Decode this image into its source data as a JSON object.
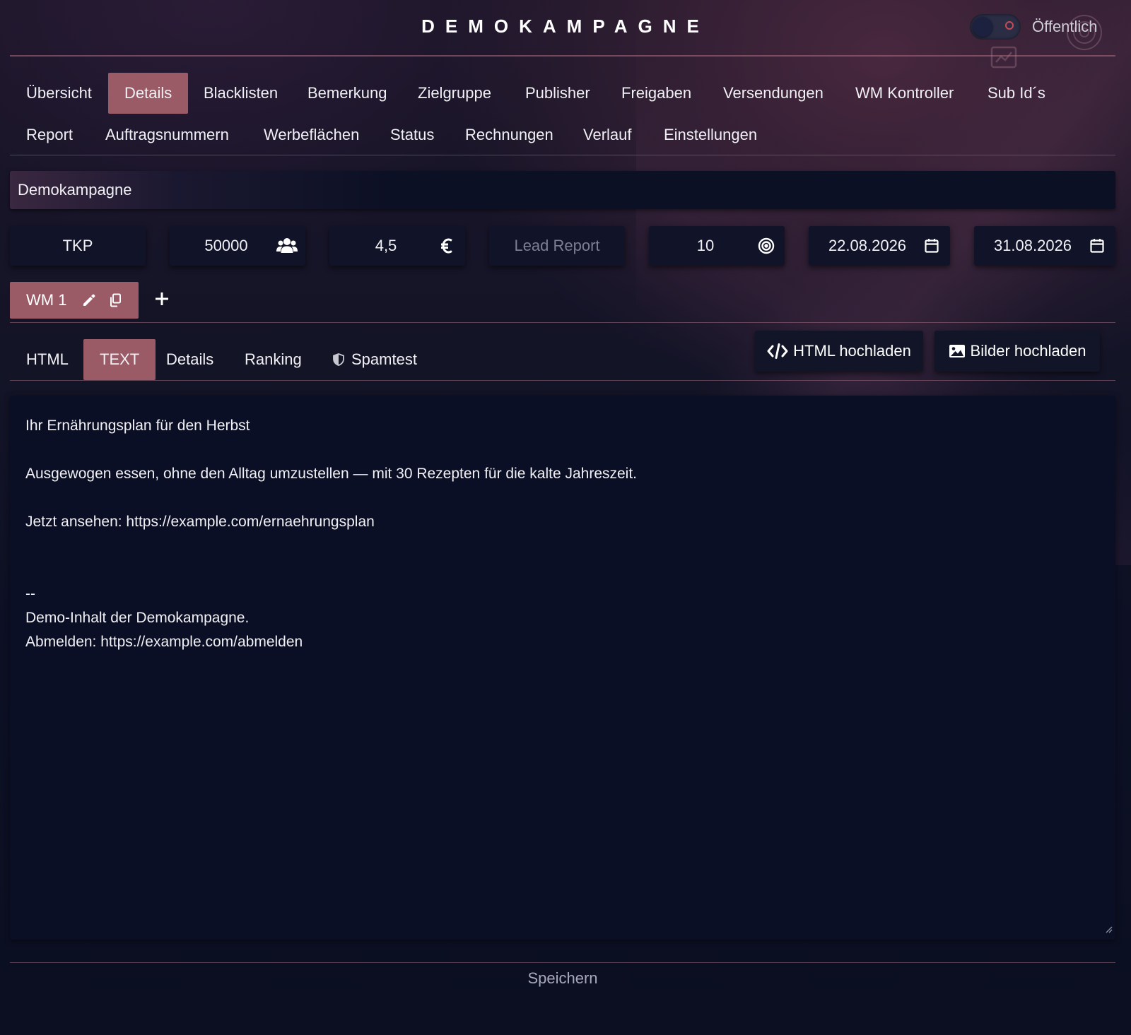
{
  "header": {
    "title": "DEMOKAMPAGNE",
    "public_toggle_label": "Öffentlich",
    "public_toggle_on": false
  },
  "nav": {
    "active": "Details",
    "row1": [
      "Übersicht",
      "Details",
      "Blacklisten",
      "Bemerkung",
      "Zielgruppe",
      "Publisher",
      "Freigaben",
      "Versendungen",
      "WM Kontroller",
      "Sub Id´s"
    ],
    "row2": [
      "Report",
      "Auftragsnummern",
      "Werbeflächen",
      "Status",
      "Rechnungen",
      "Verlauf",
      "Einstellungen"
    ]
  },
  "campaign": {
    "name": "Demokampagne"
  },
  "fields": {
    "billing_type": "TKP",
    "volume": "50000",
    "volume_icon": "users-icon",
    "price": "4,5",
    "price_icon": "euro-icon",
    "report_placeholder": "Lead Report",
    "target": "10",
    "target_icon": "target-icon",
    "start_date": "22.08.2026",
    "end_date": "31.08.2026",
    "date_icon": "calendar-icon"
  },
  "mailings": {
    "tabs": [
      {
        "label": "WM 1"
      }
    ],
    "add_icon": "plus-icon"
  },
  "content_tabs": {
    "items": [
      "HTML",
      "TEXT",
      "Details",
      "Ranking",
      "Spamtest"
    ],
    "active": "TEXT",
    "spamtest_icon": "shield-icon"
  },
  "actions": {
    "upload_html": "HTML hochladen",
    "upload_images": "Bilder hochladen"
  },
  "editor": {
    "lines": [
      "Ihr Ernährungsplan für den Herbst",
      "",
      "Ausgewogen essen, ohne den Alltag umzustellen — mit 30 Rezepten für die kalte Jahreszeit.",
      "",
      "Jetzt ansehen: https://example.com/ernaehrungsplan",
      "",
      "",
      "--",
      "Demo-Inhalt der Demokampagne.",
      "Abmelden: https://example.com/abmelden"
    ]
  },
  "footer": {
    "save_label": "Speichern"
  },
  "colors": {
    "accent": "#9a5a66",
    "background": "#0b0f21",
    "toggle_indicator": "#c94a55"
  }
}
